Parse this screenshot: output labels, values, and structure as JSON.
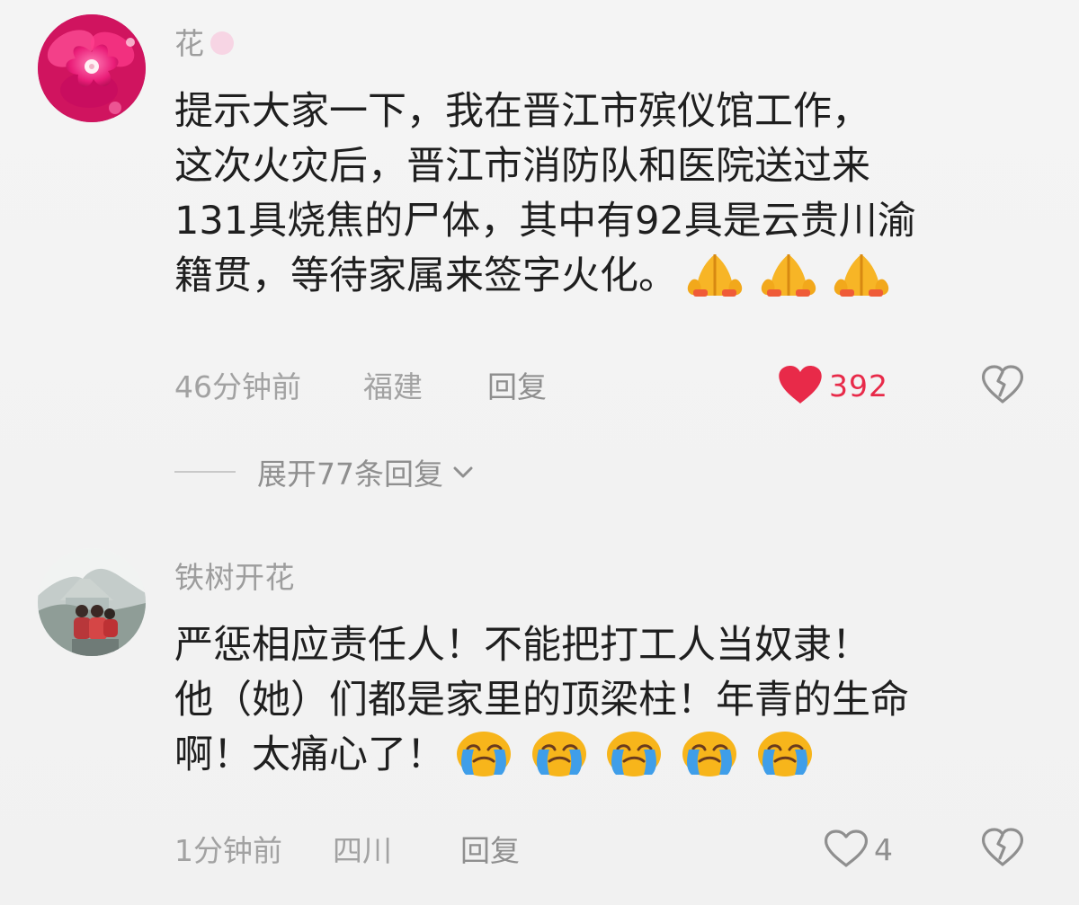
{
  "comments": [
    {
      "username": "花",
      "text_lines": [
        "提示大家一下，我在晋江市殡仪馆工作，",
        "这次火灾后，晋江市消防队和医院送过来",
        "131具烧焦的尸体，其中有92具是云贵川渝",
        "籍贯，等待家属来签字火化。"
      ],
      "emoji": [
        "folded-hands",
        "folded-hands",
        "folded-hands"
      ],
      "time": "46分钟前",
      "location": "福建",
      "reply_label": "回复",
      "likes": "392",
      "liked": true,
      "expand_label": "展开77条回复"
    },
    {
      "username": "铁树开花",
      "text_lines": [
        "严惩相应责任人！不能把打工人当奴隶！",
        "他（她）们都是家里的顶梁柱！年青的生命",
        "啊！太痛心了！"
      ],
      "emoji": [
        "crying-face",
        "crying-face",
        "crying-face",
        "crying-face",
        "crying-face"
      ],
      "time": "1分钟前",
      "location": "四川",
      "reply_label": "回复",
      "likes": "4",
      "liked": false
    }
  ],
  "colors": {
    "background": "#f3f3f3",
    "text": "#1f1f1f",
    "muted": "#a2a2a2",
    "like_red": "#e82a49",
    "emoji_yellow": "#f6b51a",
    "emoji_blue": "#3f9ee9"
  },
  "icons": {
    "like_filled": "heart-icon",
    "like_outline": "heart-outline-icon",
    "dislike": "broken-heart-icon",
    "expand": "chevron-down-icon"
  }
}
